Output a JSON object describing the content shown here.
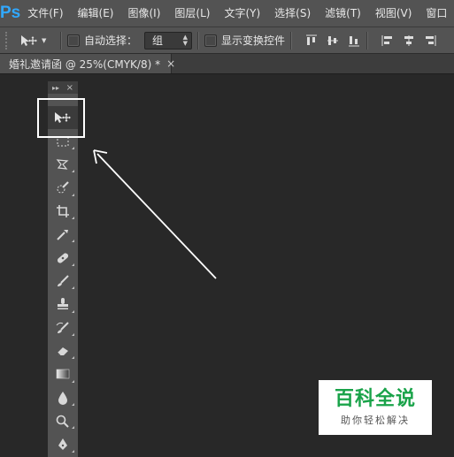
{
  "app": {
    "logo": "Ps",
    "accent": "#31a8ff"
  },
  "menu": [
    "文件(F)",
    "编辑(E)",
    "图像(I)",
    "图层(L)",
    "文字(Y)",
    "选择(S)",
    "滤镜(T)",
    "视图(V)",
    "窗口"
  ],
  "options": {
    "auto_select_label": "自动选择：",
    "auto_select_value": "组",
    "show_transform_label": "显示变换控件"
  },
  "document_tab": {
    "title": "婚礼邀请函 @ 25%(CMYK/8) *",
    "close": "×"
  },
  "tools_panel": {
    "header_collapse": "▸▸",
    "header_close": "×",
    "tools": [
      "move-tool",
      "rectangular-marquee-tool",
      "polygonal-lasso-tool",
      "quick-selection-tool",
      "crop-tool",
      "eyedropper-tool",
      "spot-healing-brush-tool",
      "brush-tool",
      "clone-stamp-tool",
      "history-brush-tool",
      "eraser-tool",
      "gradient-tool",
      "blur-tool",
      "dodge-tool",
      "pen-tool"
    ]
  },
  "watermark": {
    "title": "百科全说",
    "subtitle": "助你轻松解决",
    "title_color": "#1aa34a"
  }
}
